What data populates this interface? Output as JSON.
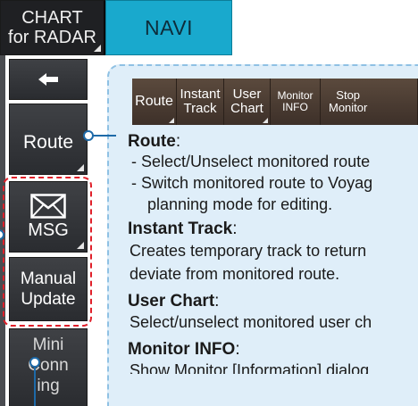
{
  "top_tabs": {
    "chart_radar_line1": "CHART",
    "chart_radar_line2": "for RADAR",
    "navi": "NAVI"
  },
  "sidebar": {
    "back_icon": "arrow-left-icon",
    "route": "Route",
    "msg_icon": "envelope-icon",
    "msg": "MSG",
    "manual_line1": "Manual",
    "manual_line2": "Update",
    "mini_line1": "Mini",
    "mini_line2": "Conn",
    "mini_line3": "ing"
  },
  "toolbar": {
    "route": "Route",
    "instant_line1": "Instant",
    "instant_line2": "Track",
    "user_line1": "User",
    "user_line2": "Chart",
    "monitor_line1": "Monitor",
    "monitor_line2": "INFO",
    "stop_line1": "Stop",
    "stop_line2": "Monitor"
  },
  "descriptions": {
    "route_heading": "Route",
    "route_line1": "- Select/Unselect monitored route",
    "route_line2": "- Switch monitored route to Voyag",
    "route_line3": "planning mode for editing.",
    "instant_heading": "Instant Track",
    "instant_line1": "Creates temporary track to return",
    "instant_line2": "deviate from monitored route.",
    "user_heading": "User Chart",
    "user_line1": "Select/unselect monitored user ch",
    "monitor_heading": "Monitor INFO",
    "monitor_line1": "Show Monitor [Information] dialog"
  },
  "colors": {
    "navi_active": "#19a9cd",
    "panel_background": "#dfeef9",
    "highlight_dashed": "#e0202a",
    "connector": "#1e6aa8"
  }
}
